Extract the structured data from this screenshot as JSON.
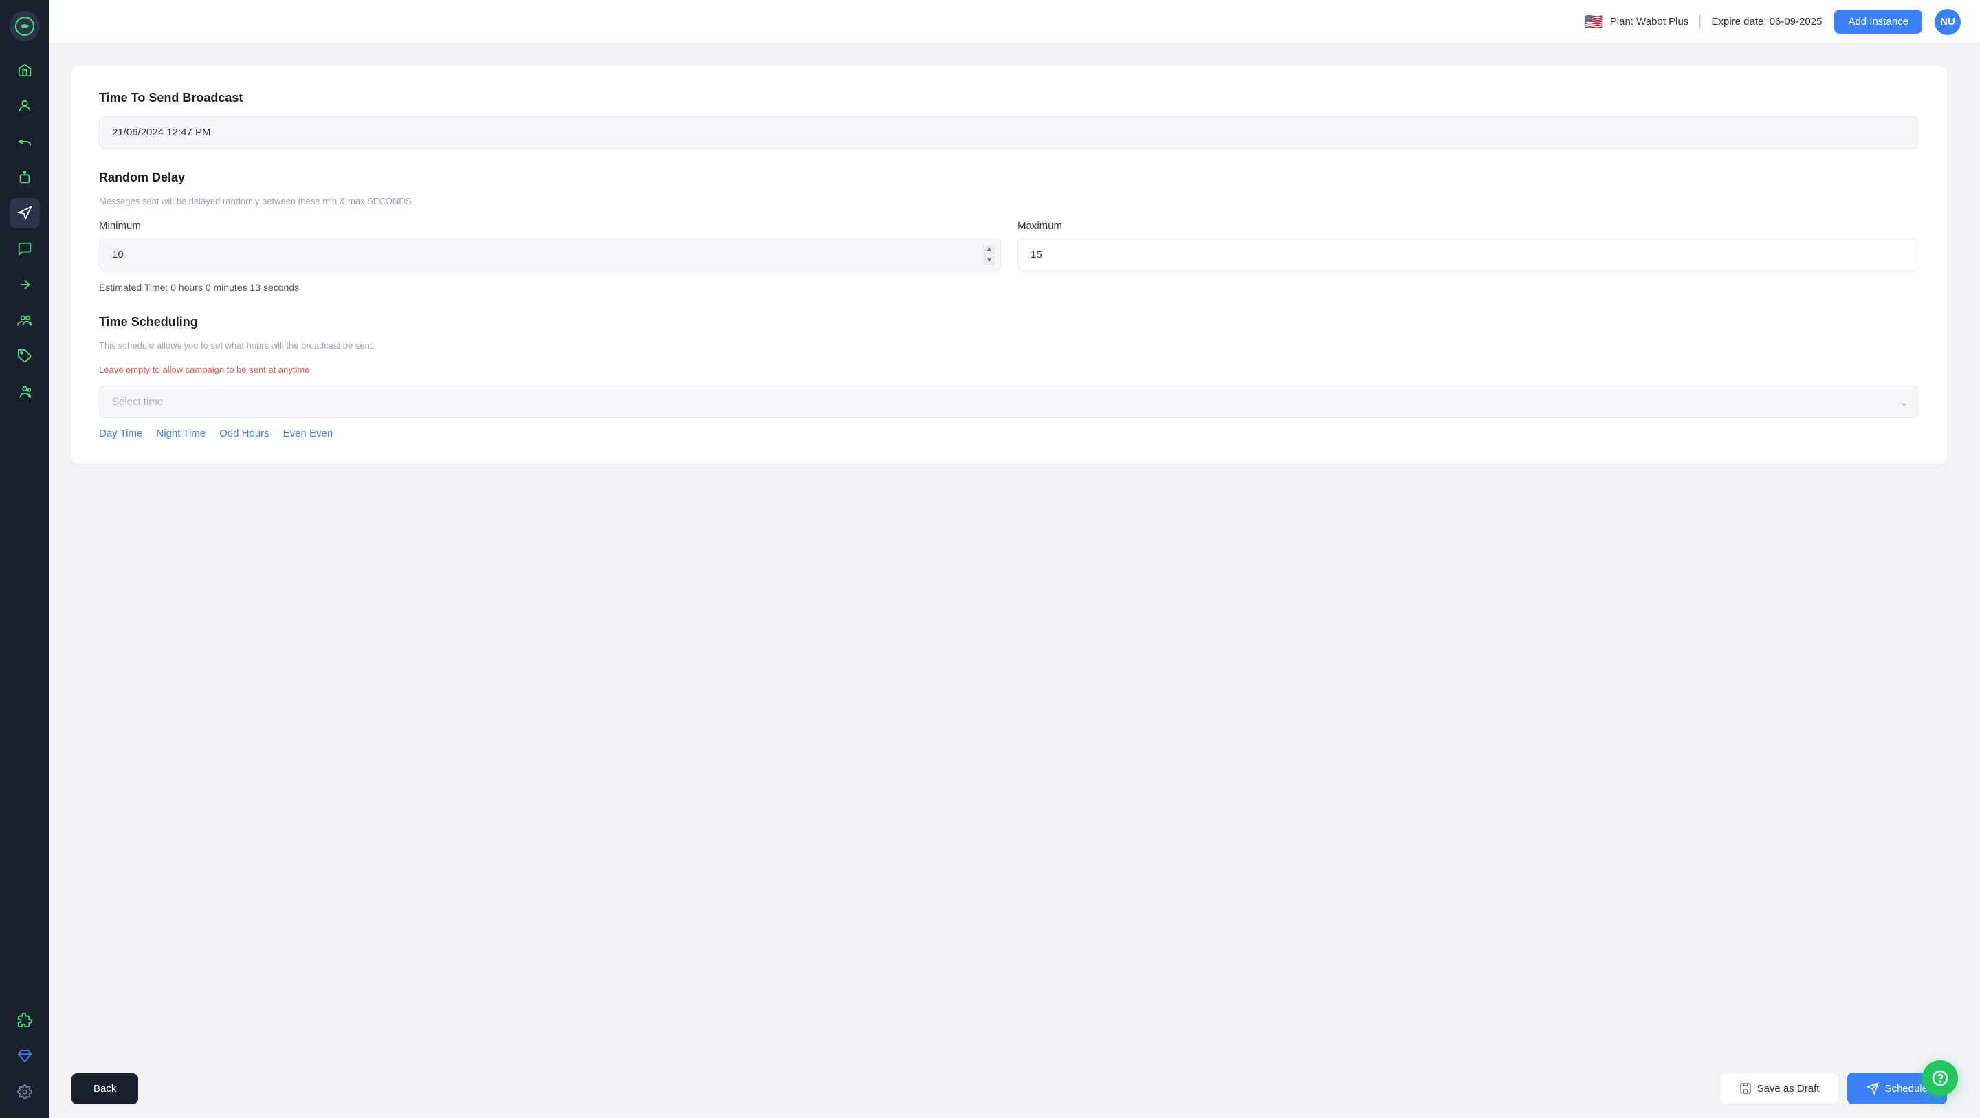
{
  "header": {
    "flag": "🇺🇸",
    "plan_label": "Plan: Wabot Plus",
    "expire_label": "Expire date: 06-09-2025",
    "add_instance_label": "Add Instance",
    "user_initials": "NU"
  },
  "sidebar": {
    "items": [
      {
        "name": "home",
        "label": "Home"
      },
      {
        "name": "contacts",
        "label": "Contacts"
      },
      {
        "name": "replies",
        "label": "Replies"
      },
      {
        "name": "bot",
        "label": "Bot"
      },
      {
        "name": "broadcast",
        "label": "Broadcast"
      },
      {
        "name": "chat",
        "label": "Chat"
      },
      {
        "name": "export",
        "label": "Export"
      },
      {
        "name": "team",
        "label": "Team"
      },
      {
        "name": "tags",
        "label": "Tags"
      },
      {
        "name": "group",
        "label": "Group"
      },
      {
        "name": "plugin",
        "label": "Plugin"
      },
      {
        "name": "diamond",
        "label": "Diamond"
      },
      {
        "name": "settings",
        "label": "Settings"
      }
    ]
  },
  "form": {
    "time_to_send": {
      "title": "Time To Send Broadcast",
      "value": "21/06/2024 12:47 PM"
    },
    "random_delay": {
      "title": "Random Delay",
      "description": "Messages sent will be delayed randomly between these min & max SECONDS",
      "minimum_label": "Minimum",
      "minimum_value": "10",
      "maximum_label": "Maximum",
      "maximum_value": "15",
      "estimated_time": "Estimated Time: 0 hours 0 minutes 13 seconds"
    },
    "time_scheduling": {
      "title": "Time Scheduling",
      "description": "This schedule allows you to set what hours will the broadcast be sent.",
      "note": "Leave empty to allow campaign to be sent at anytime",
      "select_placeholder": "Select time",
      "presets": [
        {
          "name": "day_time",
          "label": "Day Time"
        },
        {
          "name": "night_time",
          "label": "Night Time"
        },
        {
          "name": "odd_hours",
          "label": "Odd Hours"
        },
        {
          "name": "even_even",
          "label": "Even Even"
        }
      ]
    }
  },
  "footer": {
    "back_label": "Back",
    "save_draft_label": "Save as Draft",
    "schedule_label": "Schedule"
  }
}
